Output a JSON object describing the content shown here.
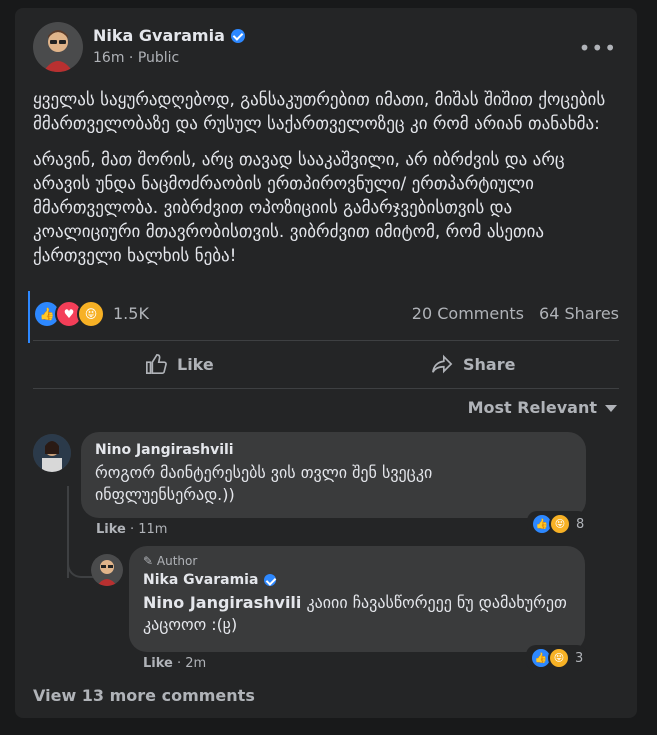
{
  "post": {
    "author": "Nika Gvaramia",
    "time": "16m",
    "visibility": "Public",
    "paragraph1": "ყველას საყურადღებოდ, განსაკუთრებით იმათი, მიშას შიშით ქოცების მმართველობაზე და რუსულ საქართველოზეც კი რომ არიან თანახმა:",
    "paragraph2": "არავინ, მათ შორის, არც თავად სააკაშვილი, არ იბრძვის და არც არავის უნდა ნაცმოძრაობის ერთპიროვნული/ ერთპარტიული მმართველობა. ვიბრძვით ოპოზიციის გამარჯვებისთვის და კოალიციური მთავრობისთვის. ვიბრძვით იმიტომ, რომ ასეთია ქართველი ხალხის ნება!"
  },
  "stats": {
    "reactions": "1.5K",
    "comments": "20 Comments",
    "shares": "64 Shares"
  },
  "actions": {
    "like": "Like",
    "share": "Share"
  },
  "sort_label": "Most Relevant",
  "comments": [
    {
      "name": "Nino Jangirashvili",
      "text": "როგორ მაინტერესებს ვის თვლი შენ სვეცკი ინფლუენსერად.))",
      "like_label": "Like",
      "time": "11m",
      "reaction_count": "8"
    }
  ],
  "reply": {
    "author_tag": "Author",
    "name": "Nika Gvaramia",
    "mention": "Nino Jangirashvili",
    "text": " კაიიი ჩავასწორეეე ნუ დამახურეთ კაცოოო :(ჸ)",
    "like_label": "Like",
    "time": "2m",
    "reaction_count": "3"
  },
  "view_more": "View 13 more comments",
  "colors": {
    "accent": "#2d88ff",
    "love": "#f33e58",
    "haha": "#f7b125",
    "card_bg": "#242526"
  },
  "icons": [
    "verified-icon",
    "more-options-icon",
    "like-reaction-icon",
    "love-reaction-icon",
    "haha-reaction-icon",
    "like-thumb-icon",
    "share-arrow-icon",
    "caret-down-icon",
    "pencil-icon"
  ]
}
